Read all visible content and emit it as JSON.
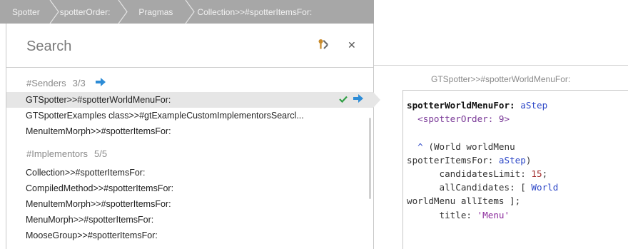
{
  "breadcrumb": {
    "items": [
      {
        "label": "Spotter"
      },
      {
        "label": "spotterOrder:"
      },
      {
        "label": "Pragmas"
      },
      {
        "label": "Collection>>#spotterItemsFor:"
      }
    ]
  },
  "search": {
    "placeholder": "Search",
    "value": ""
  },
  "categories": {
    "senders": {
      "label": "#Senders",
      "count": "3/3"
    },
    "implementors": {
      "label": "#Implementors",
      "count": "5/5"
    }
  },
  "senders": [
    {
      "label": "GTSpotter>>#spotterWorldMenuFor:"
    },
    {
      "label": "GTSpotterExamples class>>#gtExampleCustomImplementorsSearcl..."
    },
    {
      "label": "MenuItemMorph>>#spotterItemsFor:"
    }
  ],
  "implementors": [
    {
      "label": "Collection>>#spotterItemsFor:"
    },
    {
      "label": "CompiledMethod>>#spotterItemsFor:"
    },
    {
      "label": "MenuItemMorph>>#spotterItemsFor:"
    },
    {
      "label": "MenuMorph>>#spotterItemsFor:"
    },
    {
      "label": "MooseGroup>>#spotterItemsFor:"
    }
  ],
  "preview": {
    "title": "GTSpotter>>#spotterWorldMenuFor:",
    "code": {
      "selector": "spotterWorldMenuFor:",
      "arg": "aStep",
      "pragma": "<spotterOrder: 9>",
      "caret": "^",
      "l3a": "(World worldMenu",
      "l4a": "spotterItemsFor:",
      "l4b": "aStep",
      "l4c": ")",
      "l5a": "candidatesLimit:",
      "l5num": "15",
      "l5c": ";",
      "l6a": "allCandidates: [",
      "l6b": "World",
      "l7a": "worldMenu allItems ];",
      "l8a": "title:",
      "l8str": "'Menu'"
    }
  },
  "colors": {
    "breadcrumb_bg": "#a7a7a7",
    "accent_blue": "#2d8cd6",
    "check_green": "#2f9e44",
    "selected_row": "#e6e6e6"
  },
  "icons": [
    "right-arrow-icon",
    "check-icon",
    "wrench-icon",
    "close-icon"
  ]
}
